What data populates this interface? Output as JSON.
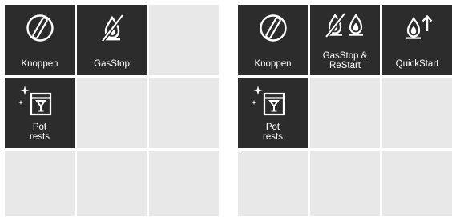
{
  "left_panel": {
    "tiles": [
      {
        "label": "Knoppen",
        "icon": "knob-icon"
      },
      {
        "label": "GasStop",
        "icon": "gas-stop-icon"
      },
      {
        "label": "Pot\nrests",
        "icon": "pot-rests-icon"
      }
    ]
  },
  "right_panel": {
    "tiles": [
      {
        "label": "Knoppen",
        "icon": "knob-icon"
      },
      {
        "label": "GasStop &\nReStart",
        "icon": "gas-stop-restart-icon"
      },
      {
        "label": "QuickStart",
        "icon": "quick-start-icon"
      },
      {
        "label": "Pot\nrests",
        "icon": "pot-rests-icon"
      }
    ]
  },
  "colors": {
    "tile_active": "#2c2c2c",
    "tile_empty": "#e8e8e8",
    "label_text": "#ffffff"
  }
}
